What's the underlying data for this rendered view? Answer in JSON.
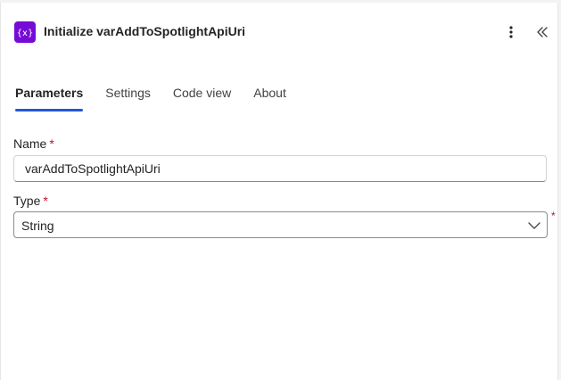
{
  "header": {
    "title": "Initialize varAddToSpotlightApiUri",
    "action_icon": "variable-braces-icon",
    "action_icon_color": "#770bd6"
  },
  "tabs": [
    {
      "label": "Parameters",
      "active": true
    },
    {
      "label": "Settings",
      "active": false
    },
    {
      "label": "Code view",
      "active": false
    },
    {
      "label": "About",
      "active": false
    }
  ],
  "form": {
    "name": {
      "label": "Name",
      "required_mark": "*",
      "value": "varAddToSpotlightApiUri"
    },
    "type": {
      "label": "Type",
      "required_mark": "*",
      "selected": "String",
      "trailing_required_mark": "*"
    }
  },
  "colors": {
    "accent": "#2557d6",
    "required": "#c50f1f"
  }
}
